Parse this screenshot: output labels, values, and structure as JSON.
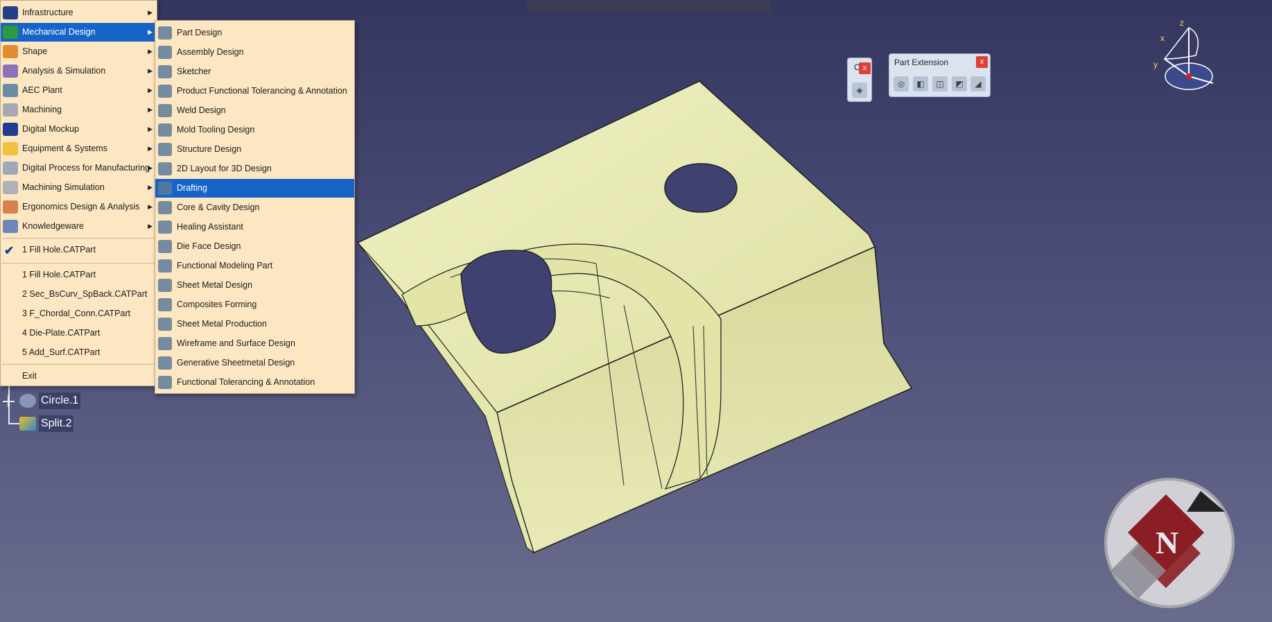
{
  "menu": {
    "main_items": [
      {
        "label": "Infrastructure",
        "icon": "infrastructure-icon",
        "color": "#243f8a"
      },
      {
        "label": "Mechanical Design",
        "icon": "mechanical-design-icon",
        "color": "#2a9b3d",
        "selected": true
      },
      {
        "label": "Shape",
        "icon": "shape-icon",
        "color": "#e48b2d"
      },
      {
        "label": "Analysis & Simulation",
        "icon": "analysis-icon",
        "color": "#8c73b8"
      },
      {
        "label": "AEC Plant",
        "icon": "aec-plant-icon",
        "color": "#6c8ca5"
      },
      {
        "label": "Machining",
        "icon": "machining-icon",
        "color": "#a7a7b0"
      },
      {
        "label": "Digital Mockup",
        "icon": "digital-mockup-icon",
        "color": "#203c8e"
      },
      {
        "label": "Equipment & Systems",
        "icon": "equipment-icon",
        "color": "#f0c040"
      },
      {
        "label": "Digital Process for Manufacturing",
        "icon": "manufacturing-icon",
        "color": "#a0a8b8"
      },
      {
        "label": "Machining Simulation",
        "icon": "machining-simulation-icon",
        "color": "#b0b0b8"
      },
      {
        "label": "Ergonomics Design & Analysis",
        "icon": "ergonomics-icon",
        "color": "#d88050"
      },
      {
        "label": "Knowledgeware",
        "icon": "knowledgeware-icon",
        "color": "#6f87b8"
      }
    ],
    "active_doc": "1 Fill Hole.CATPart",
    "recent_files": [
      "1 Fill Hole.CATPart",
      "2 Sec_BsCurv_SpBack.CATPart",
      "3 F_Chordal_Conn.CATPart",
      "4 Die-Plate.CATPart",
      "5 Add_Surf.CATPart"
    ],
    "exit_label": "Exit",
    "sub_items": [
      "Part Design",
      "Assembly Design",
      "Sketcher",
      "Product Functional Tolerancing & Annotation",
      "Weld Design",
      "Mold Tooling Design",
      "Structure Design",
      "2D Layout for 3D Design",
      "Drafting",
      "Core & Cavity Design",
      "Healing Assistant",
      "Die Face Design",
      "Functional Modeling Part",
      "Sheet Metal Design",
      "Composites Forming",
      "Sheet Metal Production",
      "Wireframe and Surface Design",
      "Generative Sheetmetal Design",
      "Functional Tolerancing & Annotation"
    ],
    "sub_selected": "Drafting"
  },
  "tree": {
    "items": [
      "Circle.1",
      "Split.2"
    ]
  },
  "toolbars": {
    "part_extension_title": "Part Extension",
    "small_title": "C",
    "close_glyph": "x"
  },
  "compass": {
    "x": "x",
    "y": "y",
    "z": "z"
  },
  "logo": {
    "letter": "N"
  },
  "colors": {
    "background_top": "#34365f",
    "background_bottom": "#6a6c8c",
    "part_fill": "#e9eab2",
    "menu_bg": "#fde7c2",
    "selection": "#1764c9"
  }
}
